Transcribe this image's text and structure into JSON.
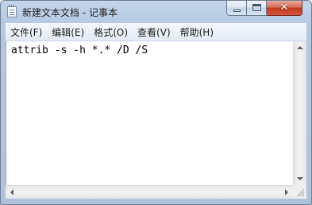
{
  "window": {
    "title": "新建文本文档 - 记事本",
    "app_icon": "notepad-icon"
  },
  "caption_buttons": {
    "minimize_icon": "minimize-icon",
    "maximize_icon": "maximize-icon",
    "close_icon": "close-icon",
    "close_glyph": "✕",
    "close_color": "#c7452a"
  },
  "menu": {
    "items": [
      {
        "label": "文件(F)"
      },
      {
        "label": "编辑(E)"
      },
      {
        "label": "格式(O)"
      },
      {
        "label": "查看(V)"
      },
      {
        "label": "帮助(H)"
      }
    ]
  },
  "editor": {
    "content": "attrib -s -h *.* /D /S"
  },
  "scrollbars": {
    "vertical": {
      "up_icon": "arrow-up-icon",
      "down_icon": "arrow-down-icon"
    },
    "horizontal": {
      "left_icon": "arrow-left-icon",
      "right_icon": "arrow-right-icon"
    },
    "size_grip_icon": "size-grip-icon"
  }
}
